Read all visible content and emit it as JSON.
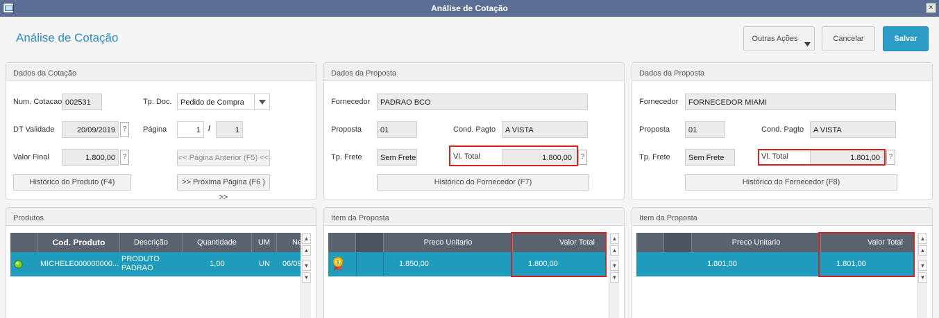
{
  "window": {
    "title": "Análise de Cotação",
    "close": "×"
  },
  "header": {
    "title": "Análise de Cotação",
    "buttons": {
      "outras_acoes": "Outras Ações",
      "cancelar": "Cancelar",
      "salvar": "Salvar"
    }
  },
  "cotacao": {
    "title": "Dados da Cotação",
    "num_label": "Num. Cotacao",
    "num_value": "002531",
    "tpdoc_label": "Tp. Doc.",
    "tpdoc_value": "Pedido de Compra",
    "validade_label": "DT Validade",
    "validade_value": "20/09/2019",
    "pagina_label": "Página",
    "pagina_value": "1",
    "pagina_sep": "/",
    "pagina_total": "1",
    "valor_label": "Valor Final",
    "valor_value": "1.800,00",
    "help": "?",
    "btn_anterior": "<< Página Anterior (F5) <<",
    "btn_historico": "Histórico do Produto (F4)",
    "btn_proxima": ">> Próxima Página (F6 ) >>"
  },
  "proposta1": {
    "title": "Dados da Proposta",
    "fornecedor_label": "Fornecedor",
    "fornecedor_value": "PADRAO BCO",
    "proposta_label": "Proposta",
    "proposta_value": "01",
    "cond_label": "Cond. Pagto",
    "cond_value": "A VISTA",
    "frete_label": "Tp. Frete",
    "frete_value": "Sem Frete",
    "vltotal_label": "Vl. Total",
    "vltotal_value": "1.800,00",
    "help": "?",
    "btn_historico": "Histórico do Fornecedor (F7)"
  },
  "proposta2": {
    "title": "Dados da Proposta",
    "fornecedor_label": "Fornecedor",
    "fornecedor_value": "FORNECEDOR MIAMI",
    "proposta_label": "Proposta",
    "proposta_value": "01",
    "cond_label": "Cond. Pagto",
    "cond_value": "A VISTA",
    "frete_label": "Tp. Frete",
    "frete_value": "Sem Frete",
    "vltotal_label": "Vl. Total",
    "vltotal_value": "1.801,00",
    "help": "?",
    "btn_historico": "Histórico do Fornecedor (F8)"
  },
  "produtos": {
    "title": "Produtos",
    "columns": [
      "Cod. Produto",
      "Descrição",
      "Quantidade",
      "UM",
      "Ne"
    ],
    "row": {
      "cod": "MICHELE000000000...",
      "desc1": "PRODUTO",
      "desc2": "PADRAO",
      "qtd": "1,00",
      "um": "UN",
      "ne": "06/09/"
    }
  },
  "item1": {
    "title": "Item da Proposta",
    "columns": [
      "Preco Unitario",
      "Valor Total"
    ],
    "row": {
      "preco": "1.850,00",
      "total": "1.800,00"
    }
  },
  "item2": {
    "title": "Item da Proposta",
    "columns": [
      "Preco Unitario",
      "Valor Total"
    ],
    "row": {
      "preco": "1.801,00",
      "total": "1.801,00"
    }
  },
  "icons": {
    "status": "green-dot-icon",
    "winner": "medal-icon",
    "dropdown": "caret-down-icon",
    "scroll_up": "arrow-up-icon",
    "scroll_down": "arrow-down-icon"
  },
  "colors": {
    "titlebar": "#5b6f95",
    "accent": "#2a9cc7",
    "grid_header": "#5a6470",
    "grid_selected": "#1e9bbd",
    "highlight": "#d9221f"
  }
}
